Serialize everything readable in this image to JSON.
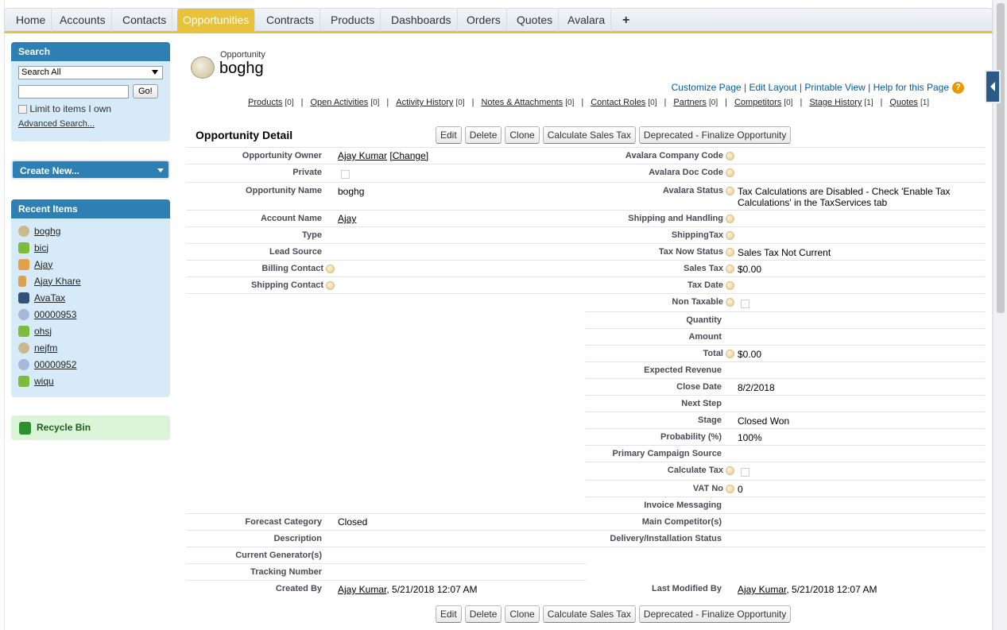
{
  "tabs": [
    {
      "label": "Home"
    },
    {
      "label": "Accounts"
    },
    {
      "label": "Contacts"
    },
    {
      "label": "Opportunities"
    },
    {
      "label": "Contracts"
    },
    {
      "label": "Products"
    },
    {
      "label": "Dashboards"
    },
    {
      "label": "Orders"
    },
    {
      "label": "Quotes"
    },
    {
      "label": "Avalara"
    },
    {
      "label": "+"
    }
  ],
  "sidebar": {
    "search": {
      "title": "Search",
      "scope": "Search All",
      "go": "Go!",
      "limit_label": "Limit to items I own",
      "advanced": "Advanced Search..."
    },
    "create_new": "Create New...",
    "recent": {
      "title": "Recent Items",
      "items": [
        {
          "label": "boghg",
          "color": "#c9b98f"
        },
        {
          "label": "bicj",
          "color": "#7dbb3c"
        },
        {
          "label": "Ajay",
          "color": "#e6a04a"
        },
        {
          "label": "Ajay Khare",
          "color": "#d9a14f"
        },
        {
          "label": "AvaTax",
          "color": "#33507a"
        },
        {
          "label": "00000953",
          "color": "#a7b8d8"
        },
        {
          "label": "ohsj",
          "color": "#7dbb3c"
        },
        {
          "label": "nejfm",
          "color": "#c9b98f"
        },
        {
          "label": "00000952",
          "color": "#a7b8d8"
        },
        {
          "label": "wiqu",
          "color": "#7dbb3c"
        }
      ]
    },
    "recycle_bin": "Recycle Bin"
  },
  "header": {
    "type": "Opportunity",
    "name": "boghg",
    "links": [
      "Customize Page",
      "Edit Layout",
      "Printable View",
      "Help for this Page"
    ],
    "related": [
      {
        "label": "Products",
        "count": "[0]"
      },
      {
        "label": "Open Activities",
        "count": "[0]"
      },
      {
        "label": "Activity History",
        "count": "[0]"
      },
      {
        "label": "Notes & Attachments",
        "count": "[0]"
      },
      {
        "label": "Contact Roles",
        "count": "[0]"
      },
      {
        "label": "Partners",
        "count": "[0]"
      },
      {
        "label": "Competitors",
        "count": "[0]"
      },
      {
        "label": "Stage History",
        "count": "[1]"
      },
      {
        "label": "Quotes",
        "count": "[1]"
      }
    ]
  },
  "detail": {
    "title": "Opportunity Detail",
    "buttons": [
      "Edit",
      "Delete",
      "Clone",
      "Calculate Sales Tax",
      "Deprecated - Finalize Opportunity"
    ],
    "left": {
      "owner_label": "Opportunity Owner",
      "owner_value": "Ajay Kumar",
      "owner_change": "[Change]",
      "private_label": "Private",
      "name_label": "Opportunity Name",
      "name_value": "boghg",
      "account_label": "Account Name",
      "account_value": "Ajay",
      "type_label": "Type",
      "lead_label": "Lead Source",
      "billing_label": "Billing Contact",
      "shipping_label": "Shipping Contact",
      "forecast_label": "Forecast Category",
      "forecast_value": "Closed",
      "description_label": "Description",
      "generator_label": "Current Generator(s)",
      "tracking_label": "Tracking Number",
      "created_label": "Created By",
      "created_user": "Ajay Kumar",
      "created_date": ", 5/21/2018 12:07 AM"
    },
    "right": {
      "company_code_label": "Avalara Company Code",
      "doc_code_label": "Avalara Doc Code",
      "status_label": "Avalara Status",
      "status_value_1": "Tax Calculations are Disabled - Check 'Enable Tax",
      "status_value_2": "Calculations' in the TaxServices tab",
      "shipping_handling_label": "Shipping and Handling",
      "shipping_tax_label": "ShippingTax",
      "tax_now_label": "Tax Now Status",
      "tax_now_value": "Sales Tax Not Current",
      "sales_tax_label": "Sales Tax",
      "sales_tax_value": "$0.00",
      "tax_date_label": "Tax Date",
      "non_taxable_label": "Non Taxable",
      "quantity_label": "Quantity",
      "amount_label": "Amount",
      "total_label": "Total",
      "total_value": "$0.00",
      "expected_label": "Expected Revenue",
      "close_date_label": "Close Date",
      "close_date_value": "8/2/2018",
      "next_step_label": "Next Step",
      "stage_label": "Stage",
      "stage_value": "Closed Won",
      "probability_label": "Probability (%)",
      "probability_value": "100%",
      "campaign_label": "Primary Campaign Source",
      "calc_tax_label": "Calculate Tax",
      "vat_label": "VAT No",
      "vat_value": "0",
      "invoice_label": "Invoice Messaging",
      "competitor_label": "Main Competitor(s)",
      "delivery_label": "Delivery/Installation Status",
      "modified_label": "Last Modified By",
      "modified_user": "Ajay Kumar",
      "modified_date": ", 5/21/2018 12:07 AM"
    }
  }
}
